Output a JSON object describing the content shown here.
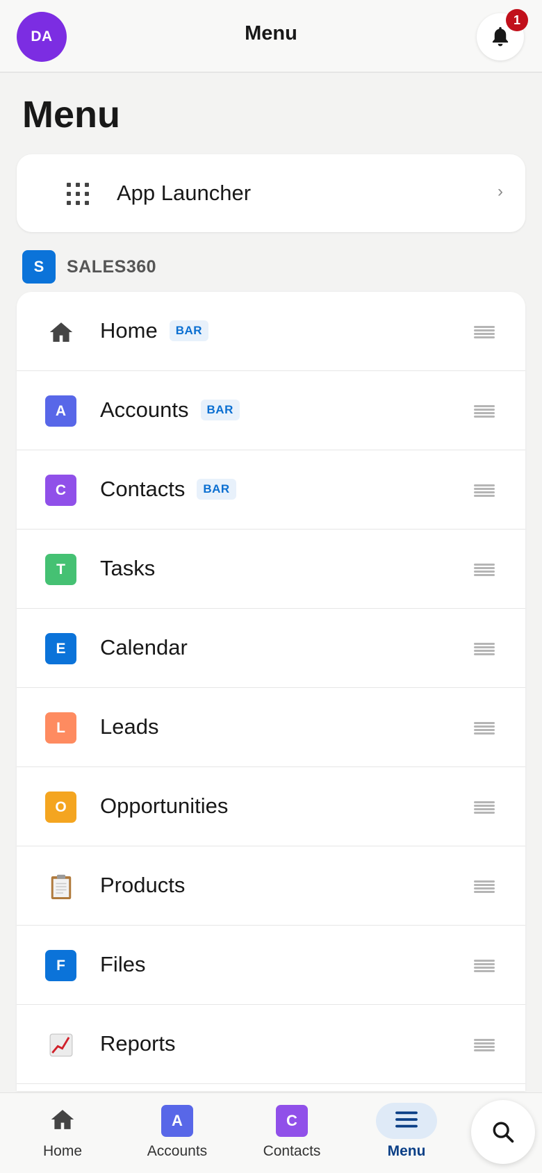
{
  "header": {
    "avatar_initials": "DA",
    "avatar_color": "#7c2de2",
    "title": "Menu",
    "notification_count": "1"
  },
  "page_title": "Menu",
  "launcher": {
    "label": "App Launcher",
    "icon": "grid-icon",
    "chevron": "›"
  },
  "section": {
    "icon_letter": "S",
    "icon_color": "#0b73d9",
    "label": "SALES360"
  },
  "items": [
    {
      "label": "Home",
      "badge": "BAR",
      "icon": "home-icon",
      "letter": "",
      "color": ""
    },
    {
      "label": "Accounts",
      "badge": "BAR",
      "icon": "letter-icon",
      "letter": "A",
      "color": "#5867e8"
    },
    {
      "label": "Contacts",
      "badge": "BAR",
      "icon": "letter-icon",
      "letter": "C",
      "color": "#9050e9"
    },
    {
      "label": "Tasks",
      "badge": "",
      "icon": "letter-icon",
      "letter": "T",
      "color": "#45c173"
    },
    {
      "label": "Calendar",
      "badge": "",
      "icon": "letter-icon",
      "letter": "E",
      "color": "#0b73d9"
    },
    {
      "label": "Leads",
      "badge": "",
      "icon": "letter-icon",
      "letter": "L",
      "color": "#fe8b60"
    },
    {
      "label": "Opportunities",
      "badge": "",
      "icon": "letter-icon",
      "letter": "O",
      "color": "#f4a520"
    },
    {
      "label": "Products",
      "badge": "",
      "icon": "clipboard-icon",
      "letter": "",
      "color": ""
    },
    {
      "label": "Files",
      "badge": "",
      "icon": "letter-icon",
      "letter": "F",
      "color": "#0b73d9"
    },
    {
      "label": "Reports",
      "badge": "",
      "icon": "chart-icon",
      "letter": "",
      "color": ""
    }
  ],
  "bottom_nav": [
    {
      "label": "Home",
      "icon": "home-icon",
      "letter": "",
      "color": "",
      "active": false
    },
    {
      "label": "Accounts",
      "icon": "letter-icon",
      "letter": "A",
      "color": "#5867e8",
      "active": false
    },
    {
      "label": "Contacts",
      "icon": "letter-icon",
      "letter": "C",
      "color": "#9050e9",
      "active": false
    },
    {
      "label": "Menu",
      "icon": "hamburger-icon",
      "letter": "",
      "color": "",
      "active": true
    }
  ],
  "search_icon": "search-icon"
}
